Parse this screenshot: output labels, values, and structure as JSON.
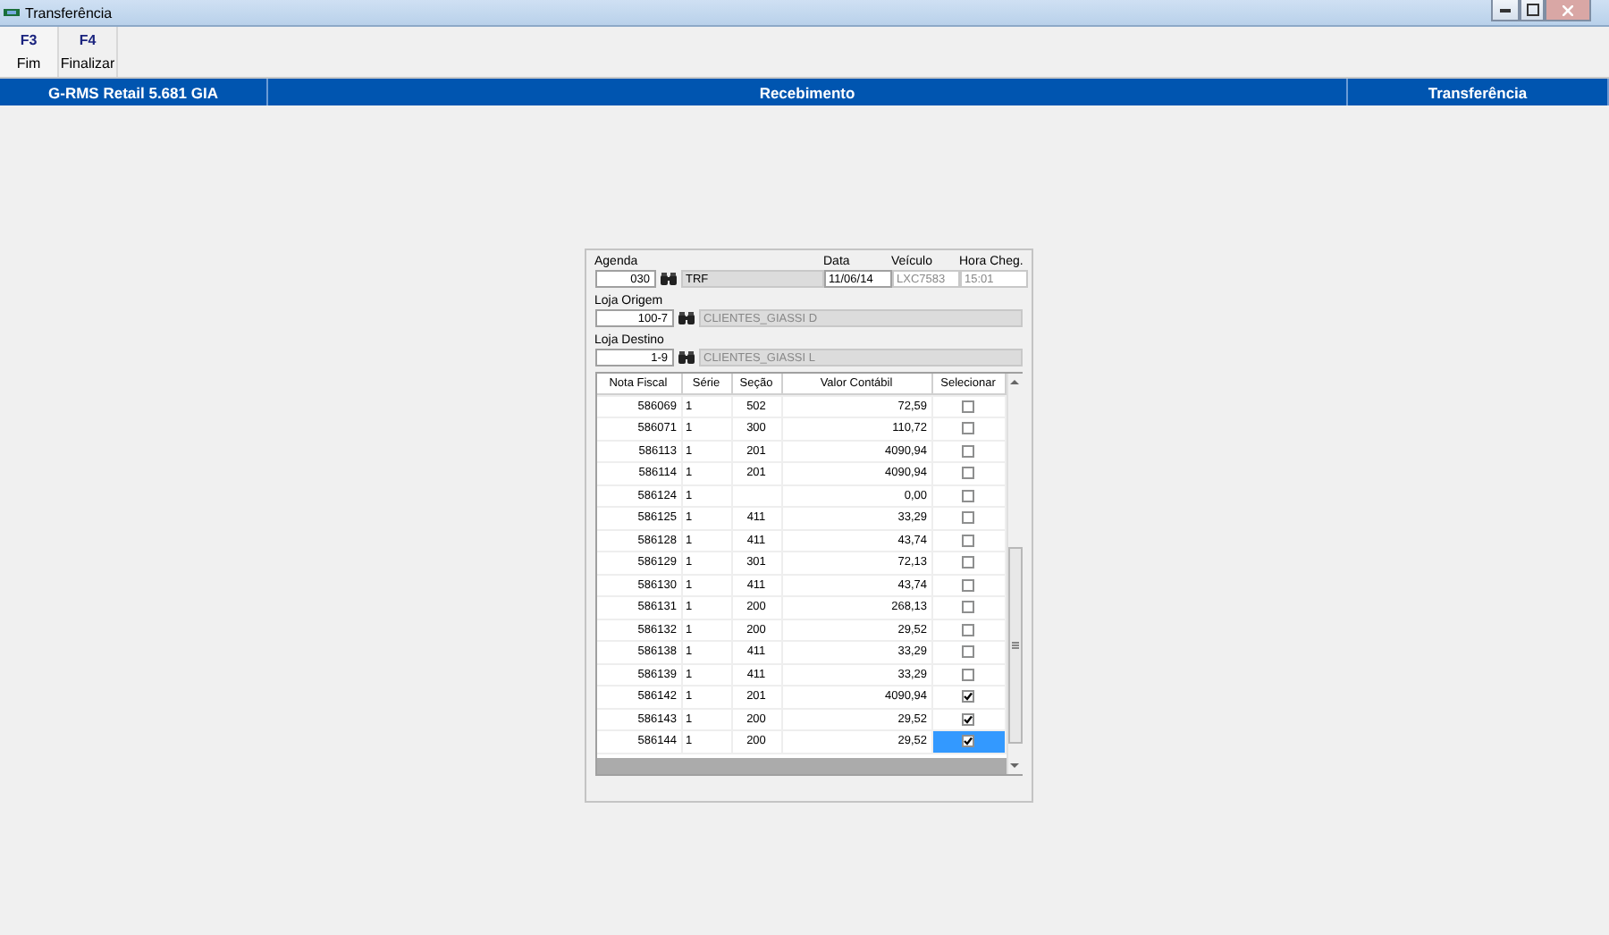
{
  "window": {
    "title": "Transferência"
  },
  "toolbar": [
    {
      "key": "F3",
      "label": "Fim"
    },
    {
      "key": "F4",
      "label": "Finalizar"
    }
  ],
  "status_bar": [
    "G-RMS Retail 5.681 GIA",
    "Recebimento",
    "Transferência"
  ],
  "form": {
    "agenda": {
      "label": "Agenda",
      "code": "030",
      "name": "TRF"
    },
    "data": {
      "label": "Data",
      "value": "11/06/14"
    },
    "veiculo": {
      "label": "Veículo",
      "value": "LXC7583"
    },
    "hora": {
      "label": "Hora Cheg.",
      "value": "15:01"
    },
    "origem": {
      "label": "Loja Origem",
      "code": "100-7",
      "name": "CLIENTES_GIASSI D"
    },
    "destino": {
      "label": "Loja Destino",
      "code": "1-9",
      "name": "CLIENTES_GIASSI L"
    }
  },
  "table": {
    "columns": [
      "Nota Fiscal",
      "Série",
      "Seção",
      "Valor Contábil",
      "Selecionar"
    ],
    "rows": [
      {
        "nota": "586069",
        "serie": "1",
        "secao": "502",
        "valor": "72,59",
        "checked": false,
        "selected": false
      },
      {
        "nota": "586071",
        "serie": "1",
        "secao": "300",
        "valor": "110,72",
        "checked": false,
        "selected": false
      },
      {
        "nota": "586113",
        "serie": "1",
        "secao": "201",
        "valor": "4090,94",
        "checked": false,
        "selected": false
      },
      {
        "nota": "586114",
        "serie": "1",
        "secao": "201",
        "valor": "4090,94",
        "checked": false,
        "selected": false
      },
      {
        "nota": "586124",
        "serie": "1",
        "valor": "0,00",
        "checked": false,
        "selected": false
      },
      {
        "nota": "586125",
        "serie": "1",
        "secao": "411",
        "valor": "33,29",
        "checked": false,
        "selected": false
      },
      {
        "nota": "586128",
        "serie": "1",
        "secao": "411",
        "valor": "43,74",
        "checked": false,
        "selected": false
      },
      {
        "nota": "586129",
        "serie": "1",
        "secao": "301",
        "valor": "72,13",
        "checked": false,
        "selected": false
      },
      {
        "nota": "586130",
        "serie": "1",
        "secao": "411",
        "valor": "43,74",
        "checked": false,
        "selected": false
      },
      {
        "nota": "586131",
        "serie": "1",
        "secao": "200",
        "valor": "268,13",
        "checked": false,
        "selected": false
      },
      {
        "nota": "586132",
        "serie": "1",
        "secao": "200",
        "valor": "29,52",
        "checked": false,
        "selected": false
      },
      {
        "nota": "586138",
        "serie": "1",
        "secao": "411",
        "valor": "33,29",
        "checked": false,
        "selected": false
      },
      {
        "nota": "586139",
        "serie": "1",
        "secao": "411",
        "valor": "33,29",
        "checked": false,
        "selected": false
      },
      {
        "nota": "586142",
        "serie": "1",
        "secao": "201",
        "valor": "4090,94",
        "checked": true,
        "selected": false
      },
      {
        "nota": "586143",
        "serie": "1",
        "secao": "200",
        "valor": "29,52",
        "checked": true,
        "selected": false
      },
      {
        "nota": "586144",
        "serie": "1",
        "secao": "200",
        "valor": "29,52",
        "checked": true,
        "selected": true
      }
    ]
  }
}
